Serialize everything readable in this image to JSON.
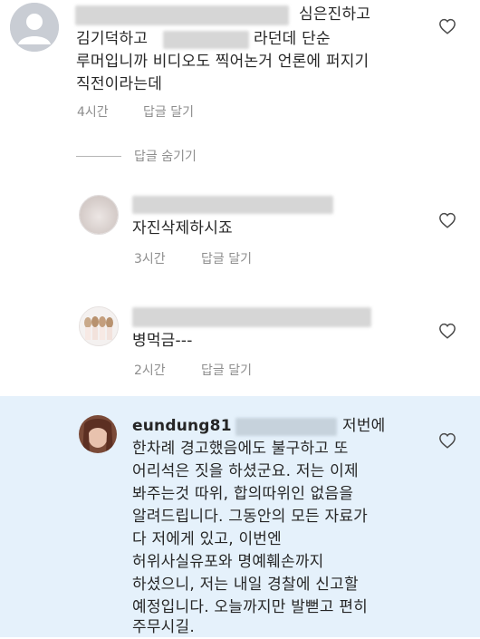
{
  "comment1": {
    "text_end_line1": "심은진하고",
    "text_line2_start": "김기덕하고",
    "text_line2_end": "라던데 단순",
    "text_line3": "루머입니까 비디오도 찍어논거 언론에 퍼지기",
    "text_line4": "직전이라는데",
    "time": "4시간",
    "reply_label": "답글 달기"
  },
  "hide_replies": "답글 숨기기",
  "reply1": {
    "text": "자진삭제하시죠",
    "time": "3시간",
    "reply_label": "답글 달기"
  },
  "reply2": {
    "text": "병먹금---",
    "time": "2시간",
    "reply_label": "답글 달기"
  },
  "reply3": {
    "username": "eundung81",
    "line1_end": "저번에",
    "lines": [
      "한차례 경고했음에도 불구하고 또",
      "어리석은 짓을 하셨군요. 저는 이제",
      "봐주는것 따위, 합의따위인 없음을",
      "알려드립니다. 그동안의 모든 자료가",
      "다 저에게 있고, 이번엔",
      "허위사실유포와 명예훼손까지",
      "하셨으니, 저는 내일 경찰에 신고할",
      "예정입니다. 오늘까지만 발뻗고 편히",
      "주무시길."
    ]
  },
  "colors": {
    "highlight": "#e5f1fb",
    "meta": "#8e8e8e",
    "text": "#262626"
  }
}
